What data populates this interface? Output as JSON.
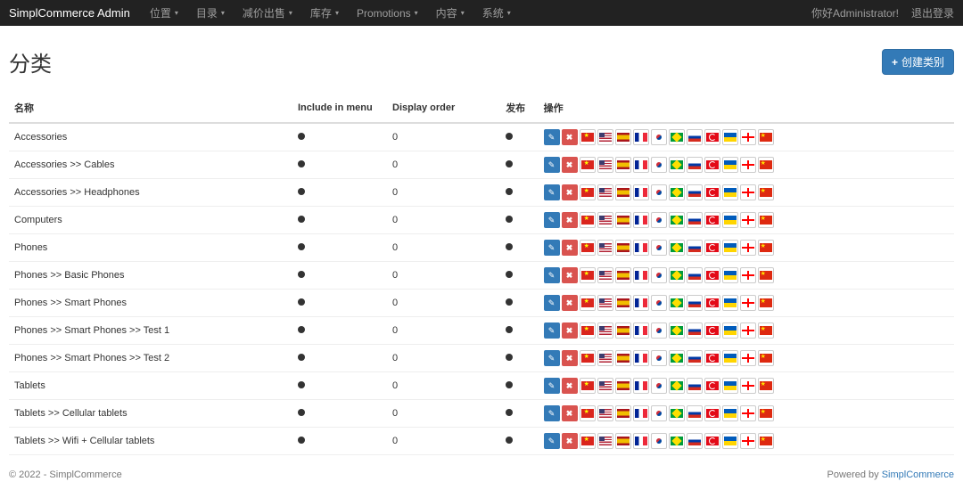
{
  "navbar": {
    "brand": "SimplCommerce Admin",
    "menus": [
      {
        "label": "位置"
      },
      {
        "label": "目录"
      },
      {
        "label": "减价出售"
      },
      {
        "label": "库存"
      },
      {
        "label": "Promotions"
      },
      {
        "label": "内容"
      },
      {
        "label": "系统"
      }
    ],
    "greeting": "你好Administrator!",
    "logout": "退出登录"
  },
  "page": {
    "title": "分类",
    "create_button": "创建类别"
  },
  "table": {
    "headers": {
      "name": "名称",
      "include_menu": "Include in menu",
      "display_order": "Display order",
      "publish": "发布",
      "action": "操作"
    },
    "rows": [
      {
        "name": "Accessories",
        "include_menu": true,
        "display_order": 0,
        "publish": true
      },
      {
        "name": "Accessories >> Cables",
        "include_menu": true,
        "display_order": 0,
        "publish": true
      },
      {
        "name": "Accessories >> Headphones",
        "include_menu": true,
        "display_order": 0,
        "publish": true
      },
      {
        "name": "Computers",
        "include_menu": true,
        "display_order": 0,
        "publish": true
      },
      {
        "name": "Phones",
        "include_menu": true,
        "display_order": 0,
        "publish": true
      },
      {
        "name": "Phones >> Basic Phones",
        "include_menu": true,
        "display_order": 0,
        "publish": true
      },
      {
        "name": "Phones >> Smart Phones",
        "include_menu": true,
        "display_order": 0,
        "publish": true
      },
      {
        "name": "Phones >> Smart Phones >> Test 1",
        "include_menu": true,
        "display_order": 0,
        "publish": true
      },
      {
        "name": "Phones >> Smart Phones >> Test 2",
        "include_menu": true,
        "display_order": 0,
        "publish": true
      },
      {
        "name": "Tablets",
        "include_menu": true,
        "display_order": 0,
        "publish": true
      },
      {
        "name": "Tablets >> Cellular tablets",
        "include_menu": true,
        "display_order": 0,
        "publish": true
      },
      {
        "name": "Tablets >> Wifi + Cellular tablets",
        "include_menu": true,
        "display_order": 0,
        "publish": true
      }
    ],
    "flags": [
      "vn",
      "us",
      "es",
      "fr",
      "kr",
      "br",
      "ru",
      "tr",
      "ua",
      "ge",
      "cn"
    ]
  },
  "footer": {
    "copyright": "© 2022 - SimplCommerce",
    "powered_by_text": "Powered by",
    "powered_by_link": "SimplCommerce"
  }
}
